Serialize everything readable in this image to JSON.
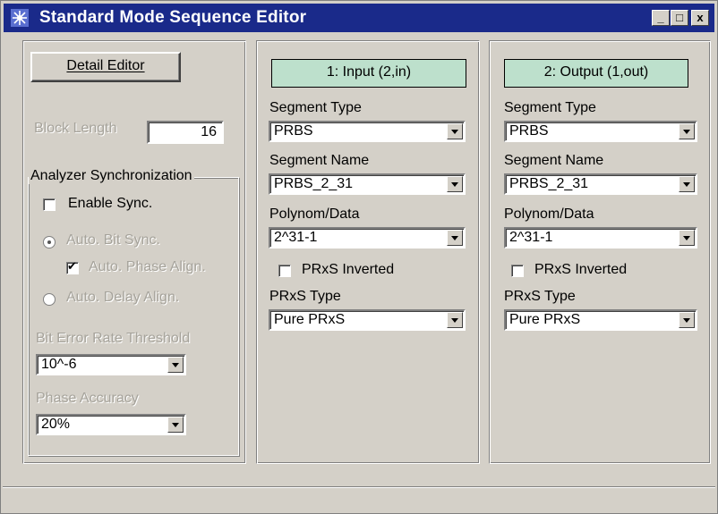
{
  "window": {
    "title": "Standard Mode Sequence Editor",
    "controls": {
      "minimize": "_",
      "maximize": "□",
      "close": "x"
    }
  },
  "left": {
    "detail_editor_label": "Detail Editor",
    "block_length_label": "Block Length",
    "block_length_value": "16",
    "sync_group_label": "Analyzer Synchronization",
    "enable_sync_label": "Enable Sync.",
    "enable_sync_checked": false,
    "auto_bit_sync_label": "Auto. Bit Sync.",
    "auto_phase_align_label": "Auto. Phase Align.",
    "auto_delay_align_label": "Auto. Delay Align.",
    "ber_threshold_label": "Bit Error Rate Threshold",
    "ber_threshold_value": "10^-6",
    "phase_accuracy_label": "Phase Accuracy",
    "phase_accuracy_value": "20%"
  },
  "channels": [
    {
      "header": "1: Input  (2,in)",
      "segment_type_label": "Segment Type",
      "segment_type_value": "PRBS",
      "segment_name_label": "Segment Name",
      "segment_name_value": "PRBS_2_31",
      "polynom_label": "Polynom/Data",
      "polynom_value": "2^31-1",
      "inverted_label": "PRxS Inverted",
      "prxs_type_label": "PRxS Type",
      "prxs_type_value": "Pure PRxS"
    },
    {
      "header": "2: Output  (1,out)",
      "segment_type_label": "Segment Type",
      "segment_type_value": "PRBS",
      "segment_name_label": "Segment Name",
      "segment_name_value": "PRBS_2_31",
      "polynom_label": "Polynom/Data",
      "polynom_value": "2^31-1",
      "inverted_label": "PRxS Inverted",
      "prxs_type_label": "PRxS Type",
      "prxs_type_value": "Pure PRxS"
    }
  ],
  "colors": {
    "title_bar": "#1a2a8a",
    "channel_header": "#bde0cc",
    "face": "#d4d0c8"
  }
}
